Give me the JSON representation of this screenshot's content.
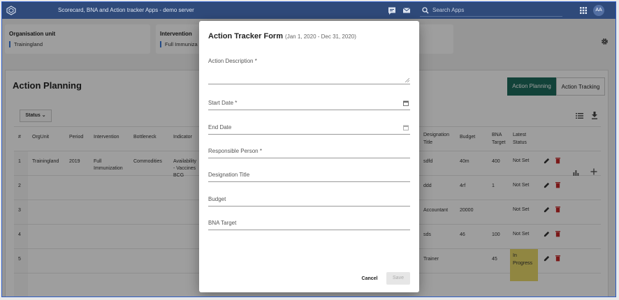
{
  "header": {
    "app_title": "Scorecard, BNA and Action tracker Apps - demo server",
    "search_placeholder": "Search Apps",
    "avatar_initials": "AA"
  },
  "filters": {
    "org_unit_label": "Organisation unit",
    "org_unit_value": "Trainingland",
    "intervention_label": "Intervention",
    "intervention_value": "Full Immuniza"
  },
  "panel": {
    "title": "Action Planning",
    "tab_planning": "Action Planning",
    "tab_tracking": "Action Tracking",
    "status_button": "Status ⌄"
  },
  "table": {
    "left_headers": [
      "#",
      "OrgUnit",
      "Period",
      "Intervention",
      "Bottleneck",
      "Indicator"
    ],
    "right_headers": [
      "Designation Title",
      "Budget",
      "BNA Target",
      "Latest Status"
    ],
    "rows": [
      {
        "num": "1",
        "org": "Trainingland",
        "period": "2019",
        "intervention": "Full Immunization",
        "bottleneck": "Commodities",
        "indicator": "Availability - Vaccines BCG",
        "designation": "sdfd",
        "budget": "40m",
        "target": "400",
        "status": "Not Set"
      },
      {
        "num": "2",
        "org": "",
        "period": "",
        "intervention": "",
        "bottleneck": "",
        "indicator": "",
        "designation": "ddd",
        "budget": "4rf",
        "target": "1",
        "status": "Not Set"
      },
      {
        "num": "3",
        "org": "",
        "period": "",
        "intervention": "",
        "bottleneck": "",
        "indicator": "",
        "designation": "Accountant",
        "budget": "20000",
        "target": "",
        "status": "Not Set"
      },
      {
        "num": "4",
        "org": "",
        "period": "",
        "intervention": "",
        "bottleneck": "",
        "indicator": "",
        "designation": "sds",
        "budget": "46",
        "target": "100",
        "status": "Not Set"
      },
      {
        "num": "5",
        "org": "",
        "period": "",
        "intervention": "",
        "bottleneck": "",
        "indicator": "",
        "designation": "Trainer",
        "budget": "",
        "target": "45",
        "status": "In Progress"
      }
    ]
  },
  "modal": {
    "title": "Action Tracker Form",
    "subtitle": "(Jan 1, 2020 - Dec 31, 2020)",
    "fields": {
      "description": "Action Description *",
      "start_date": "Start Date *",
      "end_date": "End Date",
      "responsible": "Responsible Person *",
      "designation": "Designation Title",
      "budget": "Budget",
      "bna_target": "BNA Target"
    },
    "cancel_label": "Cancel",
    "save_label": "Save"
  },
  "colors": {
    "header_bg": "#2f4a7a",
    "accent_green": "#1e6b5c",
    "in_progress": "#e9d86a",
    "delete_red": "#c62828"
  }
}
